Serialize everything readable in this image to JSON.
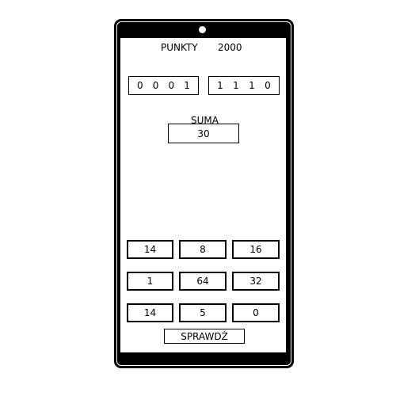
{
  "header": {
    "points_label": "PUNKTY",
    "points_value": "2000"
  },
  "binary": {
    "left": [
      "0",
      "0",
      "0",
      "1"
    ],
    "right": [
      "1",
      "1",
      "1",
      "0"
    ]
  },
  "sum": {
    "label": "SUMA",
    "value": "30"
  },
  "numbers": [
    [
      "14",
      "8",
      "16"
    ],
    [
      "1",
      "64",
      "32"
    ],
    [
      "14",
      "5",
      "0"
    ]
  ],
  "check_button": "SPRAWDŹ"
}
